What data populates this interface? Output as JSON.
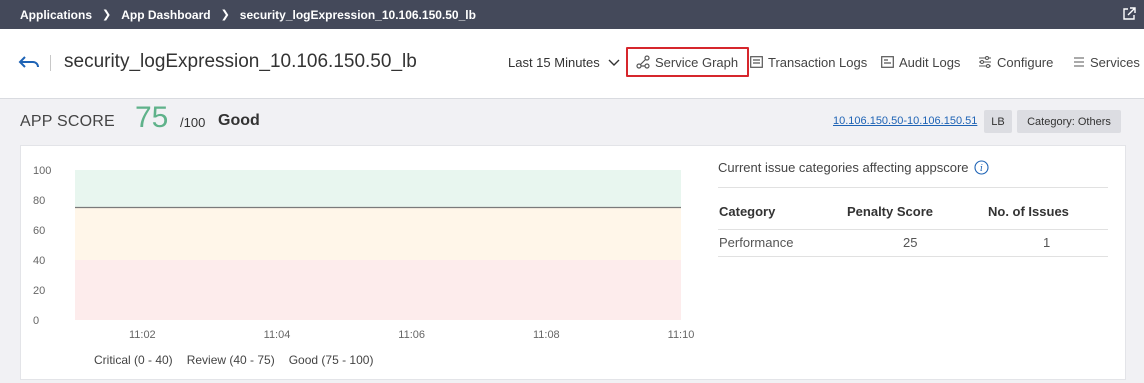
{
  "breadcrumb": {
    "items": [
      "Applications",
      "App Dashboard",
      "security_logExpression_10.106.150.50_lb"
    ]
  },
  "header": {
    "title": "security_logExpression_10.106.150.50_lb",
    "time_range": "Last 15 Minutes",
    "nav": {
      "service_graph": "Service Graph",
      "transaction_logs": "Transaction Logs",
      "audit_logs": "Audit Logs",
      "configure": "Configure",
      "services": "Services"
    },
    "active_nav": "service_graph"
  },
  "score": {
    "label": "APP SCORE",
    "value": "75",
    "max": "/100",
    "status": "Good",
    "ip_range": "10.106.150.50-10.106.150.51",
    "type_badge": "LB",
    "category_badge": "Category: Others"
  },
  "colors": {
    "score_good": "#5fb28a",
    "band_good": "#e8f6ef",
    "band_review": "#fff6e9",
    "band_critical": "#fdecec",
    "line": "#7a7a7a",
    "active_border": "#d6262c",
    "link": "#1e63b5"
  },
  "chart_data": {
    "type": "line",
    "x": [
      "11:01",
      "11:10"
    ],
    "xticks": [
      "11:02",
      "11:04",
      "11:06",
      "11:08",
      "11:10"
    ],
    "yticks": [
      "0",
      "20",
      "40",
      "60",
      "80",
      "100"
    ],
    "ylim": [
      0,
      100
    ],
    "series": [
      {
        "values": [
          75,
          75
        ]
      }
    ],
    "bands": [
      {
        "label": "Critical (0 - 40)",
        "from": 0,
        "to": 40
      },
      {
        "label": "Review (40 - 75)",
        "from": 40,
        "to": 75
      },
      {
        "label": "Good (75 - 100)",
        "from": 75,
        "to": 100
      }
    ],
    "legend": [
      "Critical (0 - 40)",
      "Review (40 - 75)",
      "Good (75 - 100)"
    ]
  },
  "issues": {
    "title": "Current issue categories affecting appscore",
    "columns": [
      "Category",
      "Penalty Score",
      "No. of Issues"
    ],
    "rows": [
      [
        "Performance",
        "25",
        "1"
      ]
    ]
  }
}
